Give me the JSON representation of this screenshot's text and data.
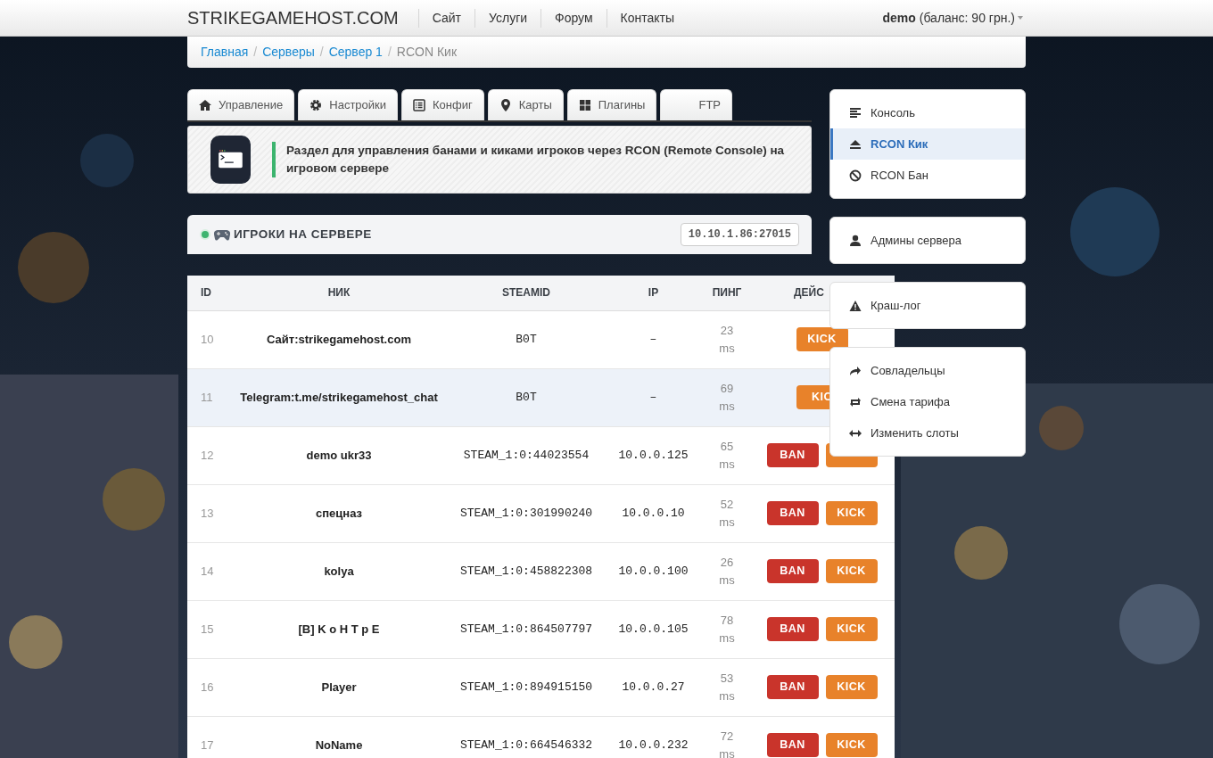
{
  "navbar": {
    "brand": "STRIKEGAMEHOST.COM",
    "links": [
      "Сайт",
      "Услуги",
      "Форум",
      "Контакты"
    ],
    "user": {
      "name": "demo",
      "balance": "(баланс: 90 грн.)"
    }
  },
  "breadcrumb": {
    "separator": "/",
    "items": [
      {
        "label": "Главная",
        "active": false
      },
      {
        "label": "Серверы",
        "active": false
      },
      {
        "label": "Сервер 1",
        "active": false
      },
      {
        "label": "RCON Кик",
        "active": true
      }
    ]
  },
  "tabs": [
    {
      "label": "Управление"
    },
    {
      "label": "Настройки"
    },
    {
      "label": "Конфиг"
    },
    {
      "label": "Карты"
    },
    {
      "label": "Плагины"
    },
    {
      "label": "FTP"
    }
  ],
  "info": {
    "text": "Раздел для управления банами и киками игроков через RCON (Remote Console) на игровом сервере"
  },
  "players_panel": {
    "title": "ИГРОКИ НА СЕРВЕРЕ",
    "address": "10.10.1.86:27015"
  },
  "table": {
    "columns": [
      "ID",
      "НИК",
      "STEAMID",
      "IP",
      "ПИНГ",
      "ДЕЙС"
    ],
    "rows": [
      {
        "id": "10",
        "nick": "Сайт:strikegamehost.com",
        "steamid": "B0T",
        "ip": "–",
        "ping": "23 ms",
        "selected": false,
        "actions": [
          {
            "kind": "kick",
            "label": "KICK"
          }
        ]
      },
      {
        "id": "11",
        "nick": "Telegram:t.me/strikegamehost_chat",
        "steamid": "B0T",
        "ip": "–",
        "ping": "69 ms",
        "selected": true,
        "actions": [
          {
            "kind": "kick",
            "label": "KIC"
          }
        ]
      },
      {
        "id": "12",
        "nick": "demo ukr33",
        "steamid": "STEAM_1:0:44023554",
        "ip": "10.0.0.125",
        "ping": "65 ms",
        "selected": false,
        "actions": [
          {
            "kind": "ban",
            "label": "BAN"
          },
          {
            "kind": "kick"
          }
        ]
      },
      {
        "id": "13",
        "nick": "спецназ",
        "steamid": "STEAM_1:0:301990240",
        "ip": "10.0.0.10",
        "ping": "52 ms",
        "selected": false,
        "actions": [
          {
            "kind": "ban",
            "label": "BAN"
          },
          {
            "kind": "kick",
            "label": "KICK"
          }
        ]
      },
      {
        "id": "14",
        "nick": "kolya",
        "steamid": "STEAM_1:0:458822308",
        "ip": "10.0.0.100",
        "ping": "26 ms",
        "selected": false,
        "actions": [
          {
            "kind": "ban",
            "label": "BAN"
          },
          {
            "kind": "kick",
            "label": "KICK"
          }
        ]
      },
      {
        "id": "15",
        "nick": "[B] K o H T p E",
        "steamid": "STEAM_1:0:864507797",
        "ip": "10.0.0.105",
        "ping": "78 ms",
        "selected": false,
        "actions": [
          {
            "kind": "ban",
            "label": "BAN"
          },
          {
            "kind": "kick",
            "label": "KICK"
          }
        ]
      },
      {
        "id": "16",
        "nick": "Player",
        "steamid": "STEAM_1:0:894915150",
        "ip": "10.0.0.27",
        "ping": "53 ms",
        "selected": false,
        "actions": [
          {
            "kind": "ban",
            "label": "BAN"
          },
          {
            "kind": "kick",
            "label": "KICK"
          }
        ]
      },
      {
        "id": "17",
        "nick": "NoName",
        "steamid": "STEAM_1:0:664546332",
        "ip": "10.0.0.232",
        "ping": "72 ms",
        "selected": false,
        "actions": [
          {
            "kind": "ban",
            "label": "BAN"
          },
          {
            "kind": "kick",
            "label": "KICK"
          }
        ]
      }
    ]
  },
  "sidebar": {
    "groups": [
      {
        "items": [
          {
            "label": "Консоль",
            "selected": false
          },
          {
            "label": "RCON Кик",
            "selected": true
          },
          {
            "label": "RCON Бан",
            "selected": false
          }
        ]
      },
      {
        "items": [
          {
            "label": "Админы сервера",
            "selected": false
          }
        ]
      },
      {
        "items": [
          {
            "label": "Краш-лог",
            "selected": false
          }
        ]
      },
      {
        "items": [
          {
            "label": "Совладельцы",
            "selected": false
          },
          {
            "label": "Смена тарифа",
            "selected": false
          },
          {
            "label": "Изменить слоты",
            "selected": false
          }
        ]
      }
    ]
  }
}
